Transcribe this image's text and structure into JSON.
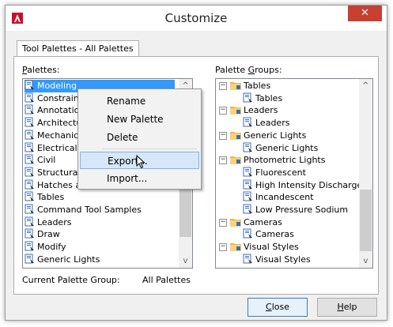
{
  "window": {
    "title": "Customize",
    "close_label": "✕"
  },
  "tab": {
    "label": "Tool Palettes - All Palettes"
  },
  "palettes": {
    "label_prefix": "",
    "label_underlined": "P",
    "label_rest": "alettes:",
    "items": [
      "Modeling",
      "Constraints",
      "Annotation",
      "Architectural",
      "Mechanical",
      "Electrical",
      "Civil",
      "Structural",
      "Hatches and Fills",
      "Tables",
      "Command Tool Samples",
      "Leaders",
      "Draw",
      "Modify",
      "Generic Lights"
    ],
    "visible_partial": [
      "Modeling",
      "Constrai",
      "Annotat",
      "Architec",
      "Mechar",
      "Electrica",
      "Civil",
      "Structur"
    ],
    "selected_index": 0
  },
  "palette_groups": {
    "label_prefix": "Palette ",
    "label_underlined": "G",
    "label_rest": "roups:",
    "tree": [
      {
        "group": "Tables",
        "child": "Tables"
      },
      {
        "group": "Leaders",
        "child": "Leaders"
      },
      {
        "group": "Generic Lights",
        "child": "Generic Lights"
      },
      {
        "group": "Photometric Lights",
        "children": [
          "Fluorescent",
          "High Intensity Discharge",
          "Incandescent",
          "Low Pressure Sodium"
        ]
      },
      {
        "group": "Cameras",
        "child": "Cameras"
      },
      {
        "group": "Visual Styles",
        "child": "Visual Styles"
      }
    ]
  },
  "context_menu": {
    "items": [
      "Rename",
      "New Palette",
      "Delete",
      "Export...",
      "Import..."
    ],
    "highlighted": "Export..."
  },
  "current_group": {
    "label": "Current Palette Group:",
    "value": "All Palettes"
  },
  "buttons": {
    "close_underlined": "C",
    "close_rest": "lose",
    "help_underlined": "H",
    "help_rest": "elp"
  },
  "colors": {
    "selection": "#3399ff",
    "close_button": "#c84031",
    "menu_highlight": "#d5e7f8"
  }
}
